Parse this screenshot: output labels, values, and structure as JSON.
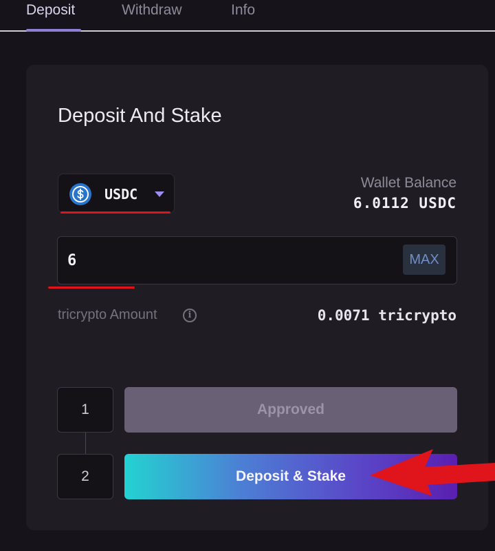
{
  "tabs": [
    {
      "label": "Deposit",
      "active": true
    },
    {
      "label": "Withdraw",
      "active": false
    },
    {
      "label": "Info",
      "active": false
    }
  ],
  "card": {
    "title": "Deposit And Stake",
    "token_select": {
      "symbol": "USDC",
      "icon": "usdc-coin-icon",
      "caret_icon": "caret-down-icon"
    },
    "wallet_balance": {
      "label": "Wallet Balance",
      "value": "6.0112 USDC"
    },
    "amount_input": {
      "value": "6",
      "max_label": "MAX"
    },
    "tricrypto": {
      "label": "tricrypto Amount",
      "info_icon": "info-icon",
      "value": "0.0071 tricrypto"
    },
    "steps": [
      {
        "number": "1",
        "button_label": "Approved",
        "state": "disabled"
      },
      {
        "number": "2",
        "button_label": "Deposit & Stake",
        "state": "active"
      }
    ]
  },
  "annotations": {
    "color": "#e0151c",
    "arrow_icon": "red-arrow-icon",
    "underlines": [
      "token-select",
      "amount-input"
    ]
  },
  "colors": {
    "background": "#16141a",
    "card": "#1f1d23",
    "accent": "#8d7fd6",
    "usdc_blue": "#2775ca",
    "gradient_start": "#23d3d2",
    "gradient_end": "#5a1fb0"
  }
}
